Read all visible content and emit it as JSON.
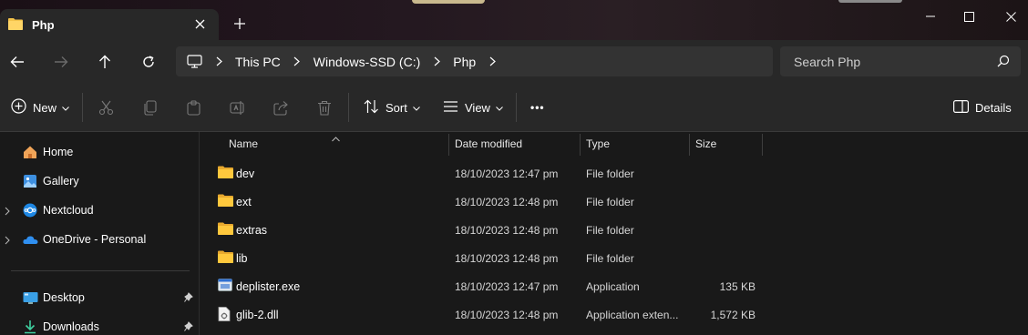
{
  "window": {
    "tab_title": "Php",
    "new_tab_symbol": "+"
  },
  "address": {
    "crumbs": [
      "This PC",
      "Windows-SSD (C:)",
      "Php"
    ],
    "search_placeholder": "Search Php"
  },
  "commands": {
    "new": "New",
    "sort": "Sort",
    "view": "View",
    "more": "•••",
    "details": "Details"
  },
  "sidebar": {
    "items": [
      {
        "label": "Home",
        "icon": "home-icon",
        "expandable": false
      },
      {
        "label": "Gallery",
        "icon": "gallery-icon",
        "expandable": false
      },
      {
        "label": "Nextcloud",
        "icon": "nextcloud-icon",
        "expandable": true
      },
      {
        "label": "OneDrive - Personal",
        "icon": "onedrive-icon",
        "expandable": true
      },
      {
        "label": "Desktop",
        "icon": "desktop-icon",
        "pinned": true
      },
      {
        "label": "Downloads",
        "icon": "downloads-icon",
        "pinned": true
      }
    ]
  },
  "columns": {
    "name": "Name",
    "date": "Date modified",
    "type": "Type",
    "size": "Size"
  },
  "files": [
    {
      "name": "dev",
      "date": "18/10/2023 12:47 pm",
      "type": "File folder",
      "size": "",
      "icon": "folder-icon"
    },
    {
      "name": "ext",
      "date": "18/10/2023 12:48 pm",
      "type": "File folder",
      "size": "",
      "icon": "folder-icon"
    },
    {
      "name": "extras",
      "date": "18/10/2023 12:48 pm",
      "type": "File folder",
      "size": "",
      "icon": "folder-icon"
    },
    {
      "name": "lib",
      "date": "18/10/2023 12:48 pm",
      "type": "File folder",
      "size": "",
      "icon": "folder-icon"
    },
    {
      "name": "deplister.exe",
      "date": "18/10/2023 12:47 pm",
      "type": "Application",
      "size": "135 KB",
      "icon": "exe-icon"
    },
    {
      "name": "glib-2.dll",
      "date": "18/10/2023 12:48 pm",
      "type": "Application exten...",
      "size": "1,572 KB",
      "icon": "dll-icon"
    }
  ],
  "colors": {
    "folder": "#f4c34a",
    "accent_blue": "#4cc2ff",
    "background": "#191919",
    "toolbar": "#282828"
  }
}
